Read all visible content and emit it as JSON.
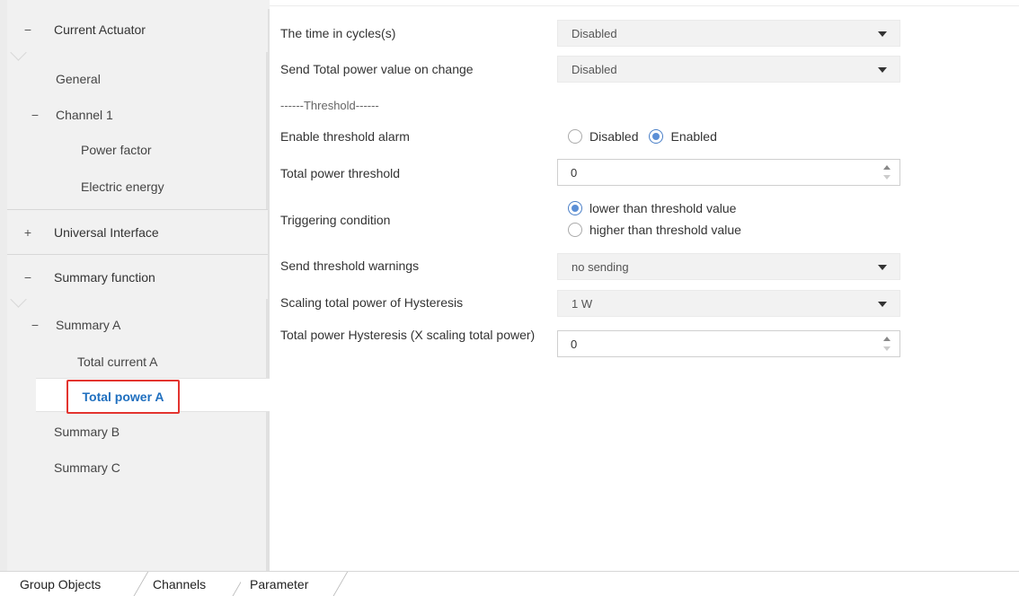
{
  "sidebar": {
    "sections": {
      "current_actuator": {
        "sign": "−",
        "label": "Current Actuator"
      },
      "universal_interface": {
        "sign": "+",
        "label": "Universal Interface"
      },
      "summary_function": {
        "sign": "−",
        "label": "Summary function"
      }
    },
    "items": {
      "general": "General",
      "channel1": {
        "sign": "−",
        "label": "Channel 1"
      },
      "power_factor": "Power factor",
      "electric_energy": "Electric energy",
      "summary_a": {
        "sign": "−",
        "label": "Summary A"
      },
      "total_current_a": "Total current A",
      "total_power_a": "Total power A",
      "summary_b": "Summary B",
      "summary_c": "Summary C"
    }
  },
  "params": {
    "time_in_cycles": {
      "label": "The time in cycles(s)",
      "value": "Disabled"
    },
    "send_total_power_on_change": {
      "label": "Send Total power value on change",
      "value": "Disabled"
    },
    "threshold_divider": "------Threshold------",
    "enable_threshold_alarm": {
      "label": "Enable threshold alarm",
      "opt_disabled": "Disabled",
      "opt_enabled": "Enabled",
      "selected": "Enabled"
    },
    "total_power_threshold": {
      "label": "Total power threshold",
      "value": "0"
    },
    "triggering_condition": {
      "label": "Triggering condition",
      "opt_lower": "lower than threshold value",
      "opt_higher": "higher than threshold value",
      "selected": "lower than threshold value"
    },
    "send_threshold_warnings": {
      "label": "Send threshold warnings",
      "value": "no sending"
    },
    "scaling_hysteresis": {
      "label": "Scaling total power of Hysteresis",
      "value": "1 W"
    },
    "total_power_hysteresis": {
      "label": "Total power Hysteresis (X scaling total power)",
      "value": "0"
    }
  },
  "tabs": {
    "group_objects": "Group Objects",
    "channels": "Channels",
    "parameter": "Parameter",
    "active": "Parameter"
  },
  "colors": {
    "accent": "#1f6fbf",
    "selection_border": "#e3342f",
    "radio_checked": "#5b8fd6"
  }
}
